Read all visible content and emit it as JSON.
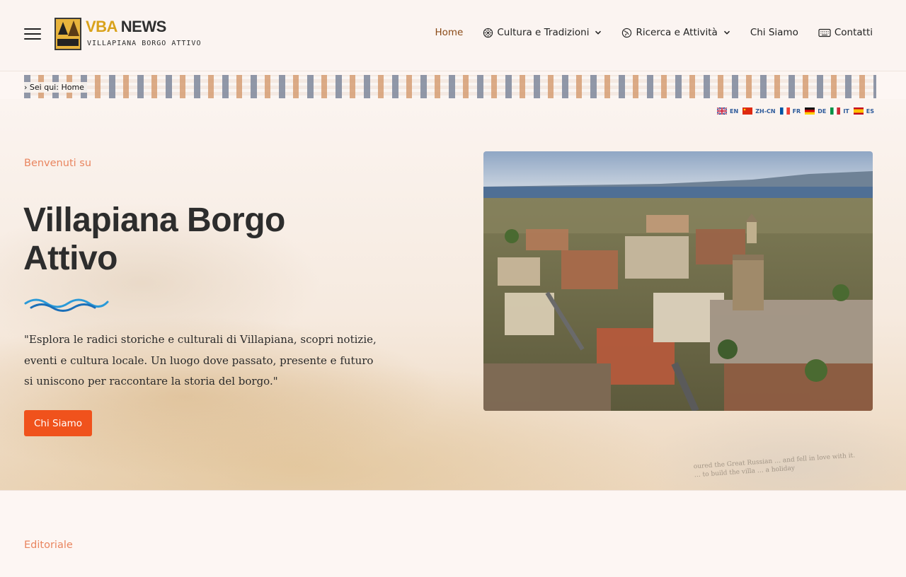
{
  "header": {
    "logo": {
      "brand_a": "VBA",
      "brand_b": "NEWS",
      "tagline": "VILLAPIANA BORGO ATTIVO"
    },
    "nav": [
      {
        "label": "Home",
        "active": true
      },
      {
        "label": "Cultura e Tradizioni",
        "icon": "flower-icon",
        "dropdown": true
      },
      {
        "label": "Ricerca e Attività",
        "icon": "globe-icon",
        "dropdown": true
      },
      {
        "label": "Chi Siamo"
      },
      {
        "label": "Contatti",
        "icon": "keyboard-icon"
      }
    ]
  },
  "breadcrumb": {
    "prefix": "›",
    "label": "Sei qui:",
    "current": "Home"
  },
  "languages": [
    {
      "code": "EN",
      "flag": "uk-flag-icon"
    },
    {
      "code": "ZH-CN",
      "flag": "china-flag-icon"
    },
    {
      "code": "FR",
      "flag": "france-flag-icon"
    },
    {
      "code": "DE",
      "flag": "germany-flag-icon"
    },
    {
      "code": "IT",
      "flag": "italy-flag-icon"
    },
    {
      "code": "ES",
      "flag": "spain-flag-icon"
    }
  ],
  "hero": {
    "eyebrow": "Benvenuti su",
    "title": "Villapiana Borgo Attivo",
    "quote": "\"Esplora le radici storiche e culturali di Villapiana, scopri notizie, eventi e cultura locale. Un luogo dove passato, presente e futuro si uniscono per raccontare la storia del borgo.\"",
    "cta_label": "Chi Siamo",
    "faint_text_1": "oured the Great Russian …          and fell in love with it.",
    "faint_text_2": "                   … to build the villa … a holiday"
  },
  "editorial": {
    "label": "Editoriale"
  },
  "colors": {
    "accent": "#f0521c",
    "eyebrow": "#e9855f",
    "nav_active": "#8a4a17",
    "logo_gold": "#d9a21b"
  }
}
